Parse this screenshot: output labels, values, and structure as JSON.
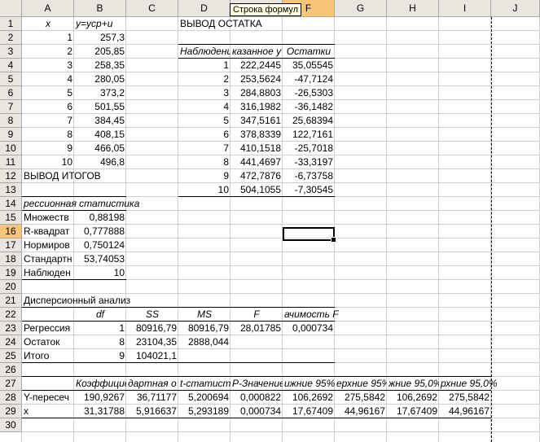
{
  "tooltip": "Строка формул",
  "columns": [
    "A",
    "B",
    "C",
    "D",
    "E",
    "F",
    "G",
    "H",
    "I",
    "J"
  ],
  "selected_column": "F",
  "selected_row": 16,
  "rows": [
    1,
    2,
    3,
    4,
    5,
    6,
    7,
    8,
    9,
    10,
    11,
    12,
    13,
    14,
    15,
    16,
    17,
    18,
    19,
    20,
    21,
    22,
    23,
    24,
    25,
    26,
    27,
    28,
    29,
    30
  ],
  "cells": [
    {
      "ref": "A1",
      "text": "x",
      "align": "c",
      "italic": true
    },
    {
      "ref": "B1",
      "text": "y=ycp+u",
      "align": "l",
      "italic": true
    },
    {
      "ref": "B2",
      "text": "257,3",
      "align": "r"
    },
    {
      "ref": "B3",
      "text": "205,85",
      "align": "r"
    },
    {
      "ref": "B4",
      "text": "258,35",
      "align": "r"
    },
    {
      "ref": "B5",
      "text": "280,05",
      "align": "r"
    },
    {
      "ref": "B6",
      "text": "373,2",
      "align": "r"
    },
    {
      "ref": "B7",
      "text": "501,55",
      "align": "r"
    },
    {
      "ref": "B8",
      "text": "384,45",
      "align": "r"
    },
    {
      "ref": "B9",
      "text": "408,15",
      "align": "r"
    },
    {
      "ref": "B10",
      "text": "466,05",
      "align": "r"
    },
    {
      "ref": "B11",
      "text": "496,8",
      "align": "r"
    },
    {
      "ref": "A2",
      "text": "1",
      "align": "r"
    },
    {
      "ref": "A3",
      "text": "2",
      "align": "r"
    },
    {
      "ref": "A4",
      "text": "3",
      "align": "r"
    },
    {
      "ref": "A5",
      "text": "4",
      "align": "r"
    },
    {
      "ref": "A6",
      "text": "5",
      "align": "r"
    },
    {
      "ref": "A7",
      "text": "6",
      "align": "r"
    },
    {
      "ref": "A8",
      "text": "7",
      "align": "r"
    },
    {
      "ref": "A9",
      "text": "8",
      "align": "r"
    },
    {
      "ref": "A10",
      "text": "9",
      "align": "r"
    },
    {
      "ref": "A11",
      "text": "10",
      "align": "r"
    },
    {
      "ref": "D1",
      "text": "ВЫВОД ОСТАТКА",
      "align": "l",
      "overflow": true
    },
    {
      "ref": "D3",
      "text": "Наблюдение",
      "align": "c",
      "italic": true
    },
    {
      "ref": "E3",
      "text": "казанное y",
      "align": "c",
      "italic": true
    },
    {
      "ref": "F3",
      "text": "Остатки",
      "align": "c",
      "italic": true
    },
    {
      "ref": "D4",
      "text": "1",
      "align": "r"
    },
    {
      "ref": "E4",
      "text": "222,2445",
      "align": "r"
    },
    {
      "ref": "F4",
      "text": "35,05545",
      "align": "r"
    },
    {
      "ref": "D5",
      "text": "2",
      "align": "r"
    },
    {
      "ref": "E5",
      "text": "253,5624",
      "align": "r"
    },
    {
      "ref": "F5",
      "text": "-47,7124",
      "align": "r"
    },
    {
      "ref": "D6",
      "text": "3",
      "align": "r"
    },
    {
      "ref": "E6",
      "text": "284,8803",
      "align": "r"
    },
    {
      "ref": "F6",
      "text": "-26,5303",
      "align": "r"
    },
    {
      "ref": "D7",
      "text": "4",
      "align": "r"
    },
    {
      "ref": "E7",
      "text": "316,1982",
      "align": "r"
    },
    {
      "ref": "F7",
      "text": "-36,1482",
      "align": "r"
    },
    {
      "ref": "D8",
      "text": "5",
      "align": "r"
    },
    {
      "ref": "E8",
      "text": "347,5161",
      "align": "r"
    },
    {
      "ref": "F8",
      "text": "25,68394",
      "align": "r"
    },
    {
      "ref": "D9",
      "text": "6",
      "align": "r"
    },
    {
      "ref": "E9",
      "text": "378,8339",
      "align": "r"
    },
    {
      "ref": "F9",
      "text": "122,7161",
      "align": "r"
    },
    {
      "ref": "D10",
      "text": "7",
      "align": "r"
    },
    {
      "ref": "E10",
      "text": "410,1518",
      "align": "r"
    },
    {
      "ref": "F10",
      "text": "-25,7018",
      "align": "r"
    },
    {
      "ref": "D11",
      "text": "8",
      "align": "r"
    },
    {
      "ref": "E11",
      "text": "441,4697",
      "align": "r"
    },
    {
      "ref": "F11",
      "text": "-33,3197",
      "align": "r"
    },
    {
      "ref": "D12",
      "text": "9",
      "align": "r"
    },
    {
      "ref": "E12",
      "text": "472,7876",
      "align": "r"
    },
    {
      "ref": "F12",
      "text": "-6,73758",
      "align": "r"
    },
    {
      "ref": "D13",
      "text": "10",
      "align": "r"
    },
    {
      "ref": "E13",
      "text": "504,1055",
      "align": "r"
    },
    {
      "ref": "F13",
      "text": "-7,30545",
      "align": "r"
    },
    {
      "ref": "A12",
      "text": "ВЫВОД ИТОГОВ",
      "align": "l",
      "overflow": true
    },
    {
      "ref": "A14",
      "text": "рессионная статистика",
      "align": "l",
      "italic": true,
      "overflow": true
    },
    {
      "ref": "A15",
      "text": "Множеств",
      "align": "l"
    },
    {
      "ref": "B15",
      "text": "0,88198",
      "align": "r"
    },
    {
      "ref": "A16",
      "text": "R-квадрат",
      "align": "l"
    },
    {
      "ref": "B16",
      "text": "0,777888",
      "align": "r"
    },
    {
      "ref": "A17",
      "text": "Нормиров",
      "align": "l"
    },
    {
      "ref": "B17",
      "text": "0,750124",
      "align": "r"
    },
    {
      "ref": "A18",
      "text": "Стандартн",
      "align": "l"
    },
    {
      "ref": "B18",
      "text": "53,74053",
      "align": "r"
    },
    {
      "ref": "A19",
      "text": "Наблюден",
      "align": "l"
    },
    {
      "ref": "B19",
      "text": "10",
      "align": "r"
    },
    {
      "ref": "A21",
      "text": "Дисперсионный анализ",
      "align": "l",
      "overflow": true
    },
    {
      "ref": "B22",
      "text": "df",
      "align": "c",
      "italic": true
    },
    {
      "ref": "C22",
      "text": "SS",
      "align": "c",
      "italic": true
    },
    {
      "ref": "D22",
      "text": "MS",
      "align": "c",
      "italic": true
    },
    {
      "ref": "E22",
      "text": "F",
      "align": "c",
      "italic": true
    },
    {
      "ref": "F22",
      "text": "ачимость F",
      "align": "l",
      "italic": true,
      "overflow": true
    },
    {
      "ref": "A23",
      "text": "Регрессия",
      "align": "l"
    },
    {
      "ref": "B23",
      "text": "1",
      "align": "r"
    },
    {
      "ref": "C23",
      "text": "80916,79",
      "align": "r"
    },
    {
      "ref": "D23",
      "text": "80916,79",
      "align": "r"
    },
    {
      "ref": "E23",
      "text": "28,01785",
      "align": "r"
    },
    {
      "ref": "F23",
      "text": "0,000734",
      "align": "r"
    },
    {
      "ref": "A24",
      "text": "Остаток",
      "align": "l"
    },
    {
      "ref": "B24",
      "text": "8",
      "align": "r"
    },
    {
      "ref": "C24",
      "text": "23104,35",
      "align": "r"
    },
    {
      "ref": "D24",
      "text": "2888,044",
      "align": "r"
    },
    {
      "ref": "A25",
      "text": "Итого",
      "align": "l"
    },
    {
      "ref": "B25",
      "text": "9",
      "align": "r"
    },
    {
      "ref": "C25",
      "text": "104021,1",
      "align": "r"
    },
    {
      "ref": "B27",
      "text": "Коэффициент",
      "align": "r",
      "italic": true
    },
    {
      "ref": "C27",
      "text": "дартная о",
      "align": "l",
      "italic": true
    },
    {
      "ref": "D27",
      "text": "t-статистика",
      "align": "l",
      "italic": true
    },
    {
      "ref": "E27",
      "text": "P-Значение",
      "align": "l",
      "italic": true
    },
    {
      "ref": "F27",
      "text": "ижние 95%",
      "align": "l",
      "italic": true
    },
    {
      "ref": "G27",
      "text": "ерхние 95%",
      "align": "l",
      "italic": true
    },
    {
      "ref": "H27",
      "text": "жние 95,0%",
      "align": "l",
      "italic": true
    },
    {
      "ref": "I27",
      "text": "рхние 95,0%",
      "align": "l",
      "italic": true,
      "overflow": true
    },
    {
      "ref": "A28",
      "text": "Y-пересеч",
      "align": "l"
    },
    {
      "ref": "B28",
      "text": "190,9267",
      "align": "r"
    },
    {
      "ref": "C28",
      "text": "36,71177",
      "align": "r"
    },
    {
      "ref": "D28",
      "text": "5,200694",
      "align": "r"
    },
    {
      "ref": "E28",
      "text": "0,000822",
      "align": "r"
    },
    {
      "ref": "F28",
      "text": "106,2692",
      "align": "r"
    },
    {
      "ref": "G28",
      "text": "275,5842",
      "align": "r"
    },
    {
      "ref": "H28",
      "text": "106,2692",
      "align": "r"
    },
    {
      "ref": "I28",
      "text": "275,5842",
      "align": "r"
    },
    {
      "ref": "A29",
      "text": "x",
      "align": "l"
    },
    {
      "ref": "B29",
      "text": "31,31788",
      "align": "r"
    },
    {
      "ref": "C29",
      "text": "5,916637",
      "align": "r"
    },
    {
      "ref": "D29",
      "text": "5,293189",
      "align": "r"
    },
    {
      "ref": "E29",
      "text": "0,000734",
      "align": "r"
    },
    {
      "ref": "F29",
      "text": "17,67409",
      "align": "r"
    },
    {
      "ref": "G29",
      "text": "44,96167",
      "align": "r"
    },
    {
      "ref": "H29",
      "text": "17,67409",
      "align": "r"
    },
    {
      "ref": "I29",
      "text": "44,96167",
      "align": "r"
    }
  ],
  "borders": [
    {
      "from": "D3",
      "to": "F3",
      "side": "top"
    },
    {
      "from": "D3",
      "to": "F3",
      "side": "bottom"
    },
    {
      "from": "D13",
      "to": "F13",
      "side": "bottom"
    },
    {
      "from": "A14",
      "to": "B14",
      "side": "top"
    },
    {
      "from": "A14",
      "to": "B14",
      "side": "bottom"
    },
    {
      "from": "A19",
      "to": "B19",
      "side": "bottom"
    },
    {
      "from": "A22",
      "to": "F22",
      "side": "top"
    },
    {
      "from": "A22",
      "to": "F22",
      "side": "bottom"
    },
    {
      "from": "A25",
      "to": "F25",
      "side": "bottom"
    },
    {
      "from": "A27",
      "to": "I27",
      "side": "top"
    },
    {
      "from": "A27",
      "to": "I27",
      "side": "bottom"
    },
    {
      "from": "A29",
      "to": "I29",
      "side": "bottom"
    }
  ]
}
